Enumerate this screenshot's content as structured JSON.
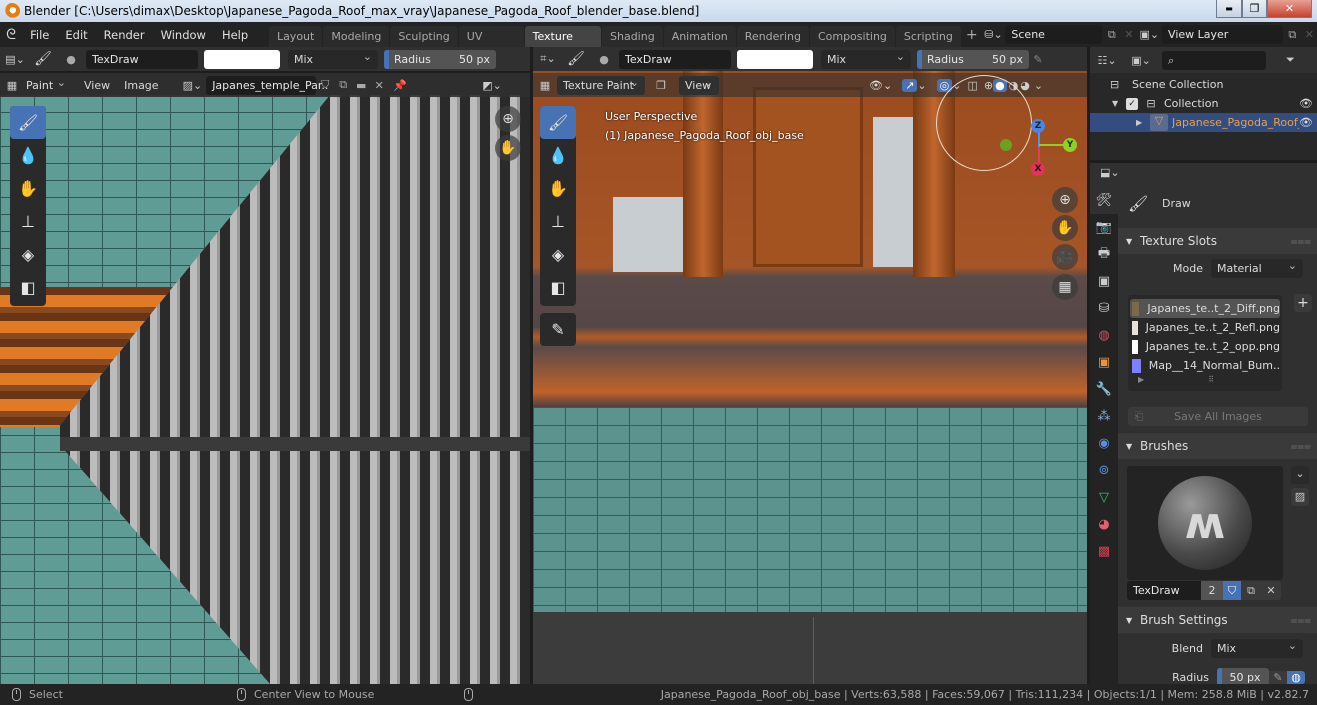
{
  "window": {
    "title": "Blender [C:\\Users\\dimax\\Desktop\\Japanese_Pagoda_Roof_max_vray\\Japanese_Pagoda_Roof_blender_base.blend]",
    "controls": {
      "minimize": "▬",
      "maximize": "❐",
      "close": "✕"
    }
  },
  "menubar": {
    "logo": "blender-logo",
    "menus": [
      "File",
      "Edit",
      "Render",
      "Window",
      "Help"
    ],
    "workspaces": [
      "Layout",
      "Modeling",
      "Sculpting",
      "UV Editing",
      "Texture Paint",
      "Shading",
      "Animation",
      "Rendering",
      "Compositing",
      "Scripting"
    ],
    "active_workspace": "Texture Paint",
    "add_workspace": "+",
    "scene": "Scene",
    "view_layer": "View Layer"
  },
  "image_editor": {
    "tool_header": {
      "brush_name": "TexDraw",
      "color": "#ffffff",
      "blend": "Mix",
      "radius_label": "Radius",
      "radius_value": "50 px"
    },
    "header": {
      "mode": "Paint",
      "view": "View",
      "image": "Image",
      "image_name": "Japanes_temple_Par.."
    },
    "tools": [
      "brush-draw",
      "soften",
      "smear",
      "clone",
      "fill",
      "mask"
    ],
    "active_tool": 0
  },
  "viewport": {
    "tool_header": {
      "brush_name": "TexDraw",
      "color": "#ffffff",
      "blend": "Mix",
      "radius_label": "Radius",
      "radius_value": "50 px"
    },
    "header": {
      "mode": "Texture Paint",
      "view": "View"
    },
    "overlay_text": {
      "line1": "User Perspective",
      "line2": "(1) Japanese_Pagoda_Roof_obj_base"
    },
    "gizmo": {
      "x": "X",
      "y": "Y",
      "z": "Z"
    },
    "tools": [
      "brush-draw",
      "soften",
      "smear",
      "clone",
      "fill",
      "mask",
      "annotate"
    ],
    "active_tool": 0
  },
  "outliner": {
    "search_placeholder": "",
    "items": [
      {
        "label": "Scene Collection",
        "level": 0
      },
      {
        "label": "Collection",
        "level": 1,
        "checked": true,
        "visible": true
      },
      {
        "label": "Japanese_Pagoda_Roof_c",
        "level": 2,
        "selected": true,
        "visible": true
      }
    ]
  },
  "properties": {
    "tool_name": "Draw",
    "texture_slots": {
      "title": "Texture Slots",
      "mode_label": "Mode",
      "mode_value": "Material",
      "slots": [
        {
          "name": "Japanes_te..t_2_Diff.png",
          "swatch": "#7a6a4a",
          "selected": true
        },
        {
          "name": "Japanes_te..t_2_Refl.png",
          "swatch": "#e8e2d6",
          "selected": false
        },
        {
          "name": "Japanes_te..t_2_opp.png",
          "swatch": "#ffffff",
          "selected": false
        },
        {
          "name": "Map__14_Normal_Bum..",
          "swatch": "#7f7fff",
          "selected": false
        }
      ],
      "save_all": "Save All Images"
    },
    "brushes": {
      "title": "Brushes",
      "brush_name": "TexDraw",
      "users": "2"
    },
    "brush_settings": {
      "title": "Brush Settings",
      "blend_label": "Blend",
      "blend_value": "Mix",
      "radius_label": "Radius",
      "radius_value": "50 px"
    }
  },
  "statusbar": {
    "left_action": "Select",
    "middle_action": "Center View to Mouse",
    "stats": "Japanese_Pagoda_Roof_obj_base | Verts:63,588 | Faces:59,067 | Tris:111,234 | Objects:1/1 | Mem: 258.8 MiB | v2.82.7"
  },
  "colors": {
    "accent": "#4772b3",
    "selected_row": "#334d80",
    "orange_text": "#e8a04a"
  }
}
